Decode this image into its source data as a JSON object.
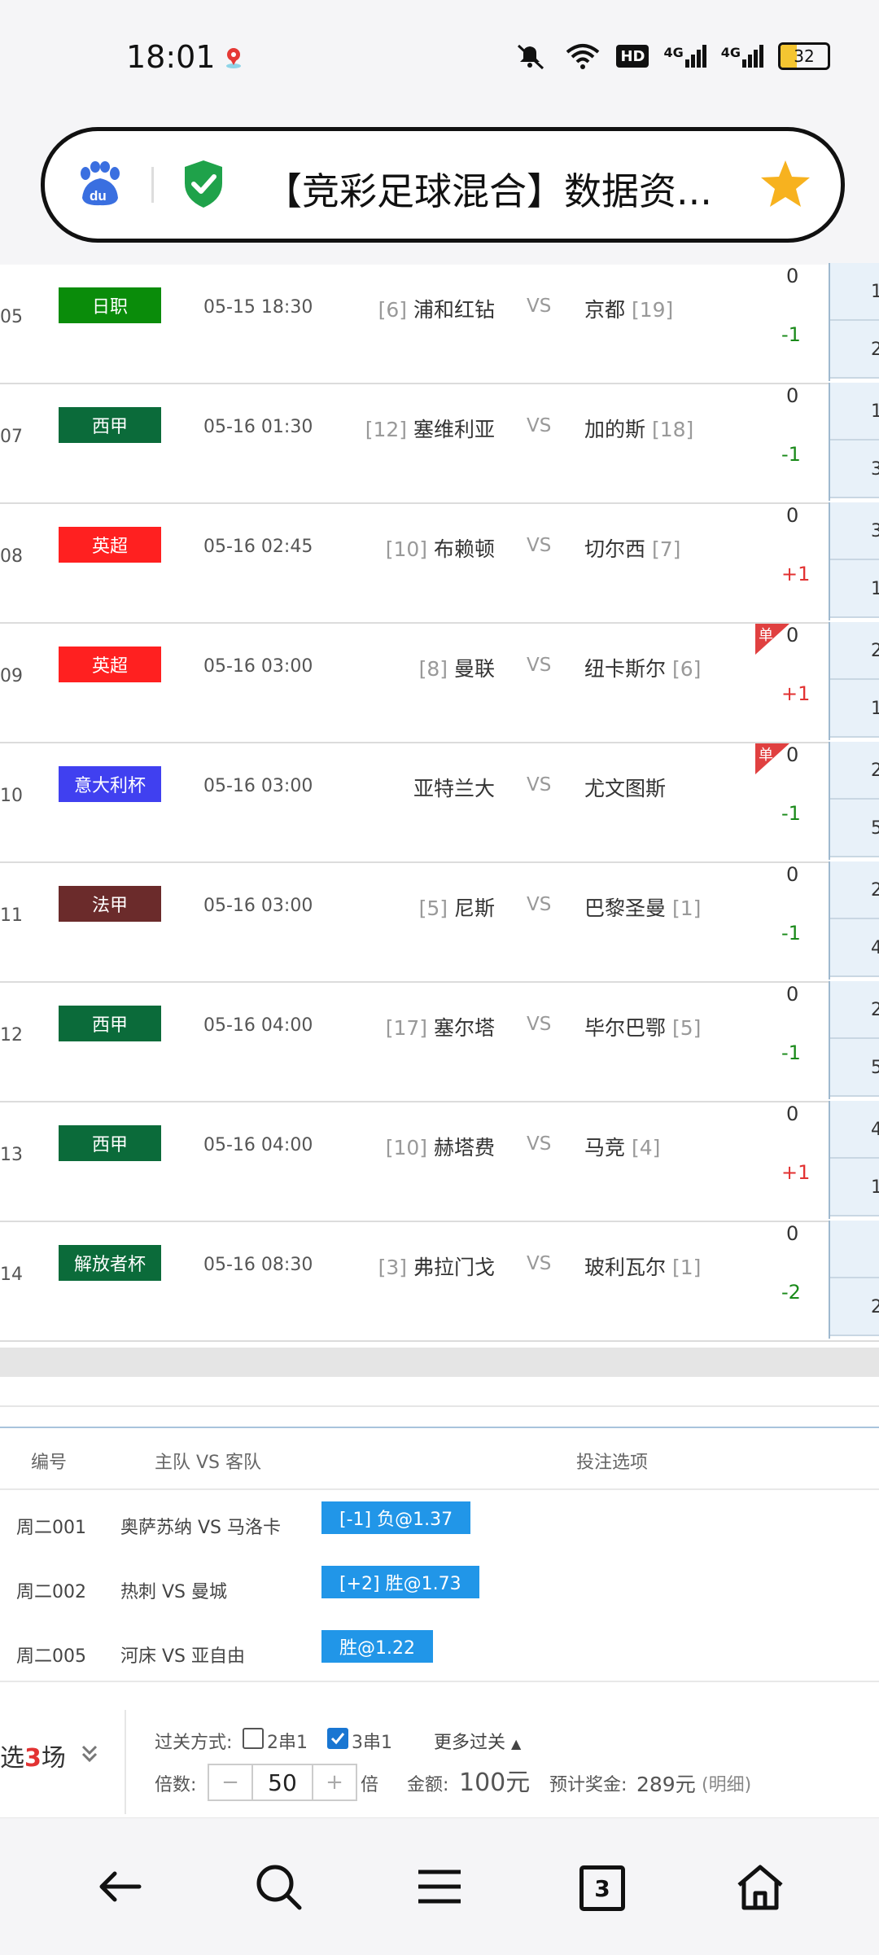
{
  "status_bar": {
    "time": "18:01",
    "icons": [
      "location-pin-icon",
      "mute-icon",
      "wifi-icon",
      "hd-icon",
      "signal-4g-icon",
      "signal-4g-icon",
      "battery-icon"
    ],
    "hd_label": "HD",
    "net1": "4G",
    "net2": "4G",
    "battery": "32"
  },
  "address_bar": {
    "title": "【竞彩足球混合】数据资...",
    "icons": [
      "baidu-logo-icon",
      "security-shield-icon",
      "star-icon"
    ]
  },
  "colors": {
    "j_league": "#0a8c0a",
    "la_liga": "#0b6b3a",
    "premier": "#ff2020",
    "coppa": "#4040f0",
    "ligue1": "#6b2b2b",
    "liberator": "#0b6b3a",
    "selection": "#2196e8",
    "accent_red": "#e23232"
  },
  "matches": [
    {
      "num": "05",
      "league": "日职",
      "color": "#0a8c0a",
      "time": "05-15 18:30",
      "home_rank": "[6]",
      "home": "浦和红钻",
      "vs": "VS",
      "away": "京都",
      "away_rank": "[19]",
      "h0": "0",
      "hc": "-1",
      "hc_color": "green",
      "o1": "1",
      "o2": "2",
      "dan": ""
    },
    {
      "num": "07",
      "league": "西甲",
      "color": "#0b6b3a",
      "time": "05-16 01:30",
      "home_rank": "[12]",
      "home": "塞维利亚",
      "vs": "VS",
      "away": "加的斯",
      "away_rank": "[18]",
      "h0": "0",
      "hc": "-1",
      "hc_color": "green",
      "o1": "1",
      "o2": "3",
      "dan": ""
    },
    {
      "num": "08",
      "league": "英超",
      "color": "#ff2020",
      "time": "05-16 02:45",
      "home_rank": "[10]",
      "home": "布赖顿",
      "vs": "VS",
      "away": "切尔西",
      "away_rank": "[7]",
      "h0": "0",
      "hc": "+1",
      "hc_color": "red",
      "o1": "3",
      "o2": "1",
      "dan": ""
    },
    {
      "num": "09",
      "league": "英超",
      "color": "#ff2020",
      "time": "05-16 03:00",
      "home_rank": "[8]",
      "home": "曼联",
      "vs": "VS",
      "away": "纽卡斯尔",
      "away_rank": "[6]",
      "h0": "0",
      "hc": "+1",
      "hc_color": "red",
      "o1": "2",
      "o2": "1",
      "dan": "单"
    },
    {
      "num": "10",
      "league": "意大利杯",
      "color": "#4040f0",
      "time": "05-16 03:00",
      "home_rank": "",
      "home": "亚特兰大",
      "vs": "VS",
      "away": "尤文图斯",
      "away_rank": "",
      "h0": "0",
      "hc": "-1",
      "hc_color": "green",
      "o1": "2",
      "o2": "5",
      "dan": "单"
    },
    {
      "num": "11",
      "league": "法甲",
      "color": "#6b2b2b",
      "time": "05-16 03:00",
      "home_rank": "[5]",
      "home": "尼斯",
      "vs": "VS",
      "away": "巴黎圣曼",
      "away_rank": "[1]",
      "h0": "0",
      "hc": "-1",
      "hc_color": "green",
      "o1": "2",
      "o2": "4",
      "dan": ""
    },
    {
      "num": "12",
      "league": "西甲",
      "color": "#0b6b3a",
      "time": "05-16 04:00",
      "home_rank": "[17]",
      "home": "塞尔塔",
      "vs": "VS",
      "away": "毕尔巴鄂",
      "away_rank": "[5]",
      "h0": "0",
      "hc": "-1",
      "hc_color": "green",
      "o1": "2",
      "o2": "5",
      "dan": ""
    },
    {
      "num": "13",
      "league": "西甲",
      "color": "#0b6b3a",
      "time": "05-16 04:00",
      "home_rank": "[10]",
      "home": "赫塔费",
      "vs": "VS",
      "away": "马竞",
      "away_rank": "[4]",
      "h0": "0",
      "hc": "+1",
      "hc_color": "red",
      "o1": "4",
      "o2": "1",
      "dan": ""
    },
    {
      "num": "14",
      "league": "解放者杯",
      "color": "#0b6b3a",
      "time": "05-16 08:30",
      "home_rank": "[3]",
      "home": "弗拉门戈",
      "vs": "VS",
      "away": "玻利瓦尔",
      "away_rank": "[1]",
      "h0": "0",
      "hc": "-2",
      "hc_color": "green",
      "o1": "",
      "o2": "2",
      "dan": ""
    }
  ],
  "bet_table": {
    "headers": {
      "num": "编号",
      "teams": "主队 VS 客队",
      "options": "投注选项"
    },
    "rows": [
      {
        "week": "周二001",
        "teams": "奥萨苏纳 VS 马洛卡",
        "selection": "[-1] 负@1.37"
      },
      {
        "week": "周二002",
        "teams": "热刺 VS 曼城",
        "selection": "[+2] 胜@1.73"
      },
      {
        "week": "周二005",
        "teams": "河床 VS 亚自由",
        "selection": "胜@1.22"
      }
    ]
  },
  "controls": {
    "selected_prefix": "选",
    "selected_count": "3",
    "selected_suffix": "场",
    "pass_label": "过关方式:",
    "opt1": "2串1",
    "opt1_checked": false,
    "opt2": "3串1",
    "opt2_checked": true,
    "more": "更多过关",
    "multiplier_label": "倍数:",
    "minus": "−",
    "multiplier": "50",
    "plus": "+",
    "times": "倍",
    "amount_label": "金额:",
    "amount": "100元",
    "prize_label": "预计奖金:",
    "prize": "289元",
    "detail": "(明细)"
  },
  "nav": {
    "tab_count": "3",
    "icons": [
      "back-arrow-icon",
      "search-icon",
      "menu-icon",
      "tabs-icon",
      "home-icon"
    ]
  }
}
